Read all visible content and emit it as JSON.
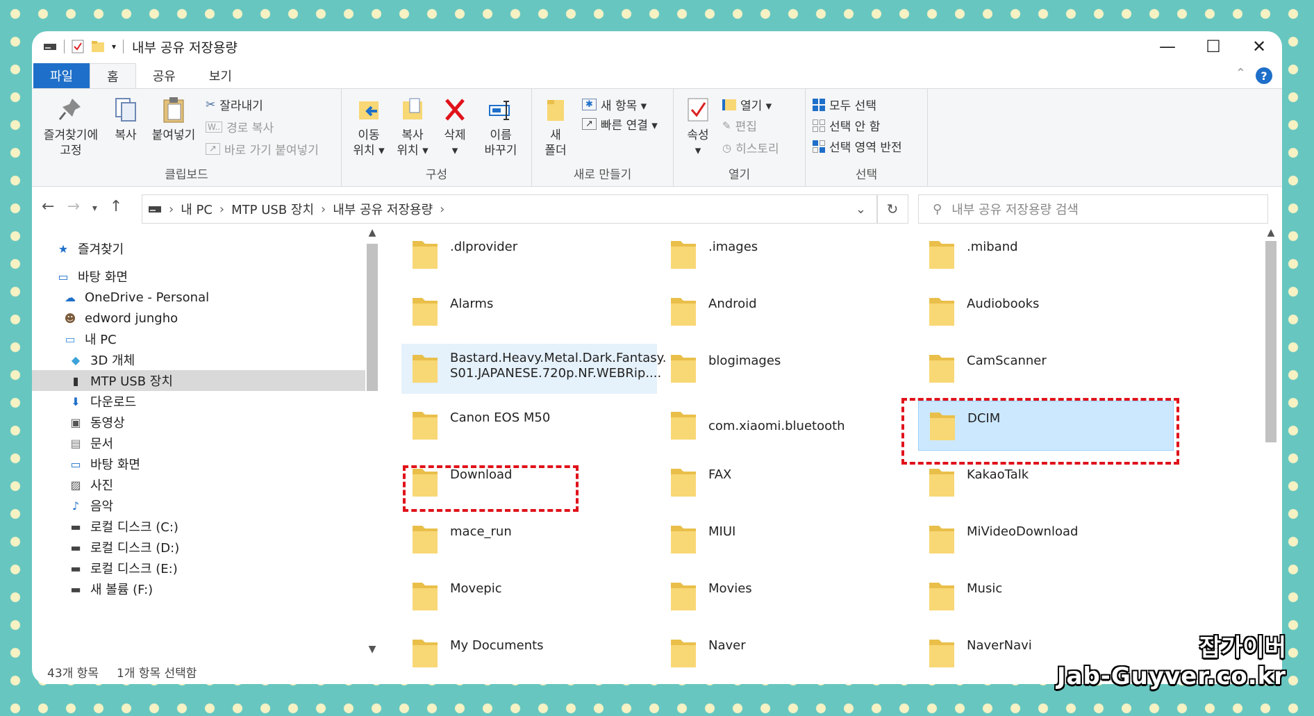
{
  "window": {
    "title": "내부 공유 저장용량",
    "controls": {
      "minimize": "—",
      "maximize": "☐",
      "close": "✕"
    }
  },
  "ribbon_tabs": [
    "파일",
    "홈",
    "공유",
    "보기"
  ],
  "help_label": "?",
  "ribbon": {
    "clipboard": {
      "label": "클립보드",
      "pin": "즐겨찾기에\n고정",
      "copy": "복사",
      "paste": "붙여넣기",
      "cut": "잘라내기",
      "copy_path": "경로 복사",
      "paste_shortcut": "바로 가기 붙여넣기"
    },
    "organize": {
      "label": "구성",
      "move_to": "이동\n위치 ▾",
      "copy_to": "복사\n위치 ▾",
      "delete": "삭제\n▾",
      "rename": "이름\n바꾸기"
    },
    "new": {
      "label": "새로 만들기",
      "new_folder": "새\n폴더",
      "new_item": "새 항목 ▾",
      "easy_access": "빠른 연결 ▾"
    },
    "open": {
      "label": "열기",
      "properties": "속성\n▾",
      "open": "열기 ▾",
      "edit": "편집",
      "history": "히스토리"
    },
    "select": {
      "label": "선택",
      "select_all": "모두 선택",
      "select_none": "선택 안 함",
      "invert": "선택 영역 반전"
    }
  },
  "address": {
    "breadcrumb": [
      "내 PC",
      "MTP USB 장치",
      "내부 공유 저장용량"
    ],
    "search_placeholder": "내부 공유 저장용량 검색"
  },
  "nav_tree": [
    {
      "label": "즐겨찾기",
      "icon": "star-icon"
    },
    {
      "label": "바탕 화면",
      "icon": "desktop-icon"
    },
    {
      "label": "OneDrive - Personal",
      "icon": "cloud-icon"
    },
    {
      "label": "edword jungho",
      "icon": "user-icon"
    },
    {
      "label": "내 PC",
      "icon": "pc-icon"
    },
    {
      "label": "3D 개체",
      "icon": "cube-icon"
    },
    {
      "label": "MTP USB 장치",
      "icon": "phone-icon",
      "selected": true
    },
    {
      "label": "다운로드",
      "icon": "download-icon"
    },
    {
      "label": "동영상",
      "icon": "video-icon"
    },
    {
      "label": "문서",
      "icon": "document-icon"
    },
    {
      "label": "바탕 화면",
      "icon": "desktop-icon"
    },
    {
      "label": "사진",
      "icon": "picture-icon"
    },
    {
      "label": "음악",
      "icon": "music-icon"
    },
    {
      "label": "로컬 디스크 (C:)",
      "icon": "drive-icon"
    },
    {
      "label": "로컬 디스크 (D:)",
      "icon": "drive-icon"
    },
    {
      "label": "로컬 디스크 (E:)",
      "icon": "drive-icon"
    },
    {
      "label": "새 볼륨 (F:)",
      "icon": "drive-icon"
    }
  ],
  "folders": [
    ".dlprovider",
    ".images",
    ".miband",
    "Alarms",
    "Android",
    "Audiobooks",
    "Bastard.Heavy.Metal.Dark.Fantasy.\nS01.JAPANESE.720p.NF.WEBRip....",
    "blogimages",
    "CamScanner",
    "Canon EOS M50",
    "com.xiaomi.bluetooth",
    "DCIM",
    "Download",
    "FAX",
    "KakaoTalk",
    "mace_run",
    "MIUI",
    "MiVideoDownload",
    "Movepic",
    "Movies",
    "Music",
    "My Documents",
    "Naver",
    "NaverNavi"
  ],
  "status": {
    "count": "43개 항목",
    "selected": "1개 항목 선택함"
  },
  "watermark": {
    "line1": "잡가이버",
    "line2": "Jab-Guyver.co.kr"
  },
  "colors": {
    "accent": "#1e6fc9",
    "highlight": "#e0121a",
    "folder": "#f8d775",
    "selected_bg": "#cce8ff"
  }
}
